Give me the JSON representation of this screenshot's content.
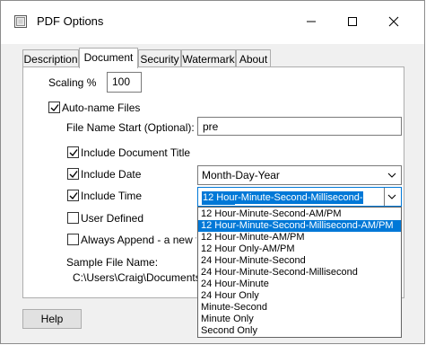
{
  "window": {
    "title": "PDF Options",
    "controls": {
      "minimize_icon": "minimize-icon",
      "maximize_icon": "maximize-icon",
      "close_icon": "close-icon"
    }
  },
  "tabs": [
    {
      "label": "Description",
      "active": false
    },
    {
      "label": "Document",
      "active": true
    },
    {
      "label": "Security",
      "active": false
    },
    {
      "label": "Watermark",
      "active": false
    },
    {
      "label": "About",
      "active": false
    }
  ],
  "document": {
    "scaling_label": "Scaling %",
    "scaling_value": "100",
    "autoname_label": "Auto-name Files",
    "autoname_checked": true,
    "filename_start_label": "File Name Start (Optional):",
    "filename_start_value": "pre",
    "include_title_label": "Include Document Title",
    "include_title_checked": true,
    "include_date_label": "Include Date",
    "include_date_checked": true,
    "date_format_value": "Month-Day-Year",
    "include_time_label": "Include Time",
    "include_time_checked": true,
    "time_format_value": "12 Hour-Minute-Second-Millisecond-AM/PM",
    "user_defined_label": "User Defined",
    "user_defined_checked": false,
    "always_append_label": "Always Append - a new file",
    "always_append_checked": false,
    "sample_label": "Sample File Name:",
    "sample_value": "C:\\Users\\Craig\\Documents\\ju"
  },
  "time_dropdown": {
    "options": [
      "12 Hour-Minute-Second-AM/PM",
      "12 Hour-Minute-Second-Millisecond-AM/PM",
      "12 Hour-Minute-AM/PM",
      "12 Hour Only-AM/PM",
      "24 Hour-Minute-Second",
      "24 Hour-Minute-Second-Millisecond",
      "24 Hour-Minute",
      "24 Hour Only",
      "Minute-Second",
      "Minute Only",
      "Second Only"
    ],
    "highlighted_index": 1
  },
  "footer": {
    "help_label": "Help"
  },
  "colors": {
    "accent": "#0078d7",
    "window_bg": "#f0f0f0",
    "panel_bg": "#ffffff",
    "border": "#adadad"
  }
}
